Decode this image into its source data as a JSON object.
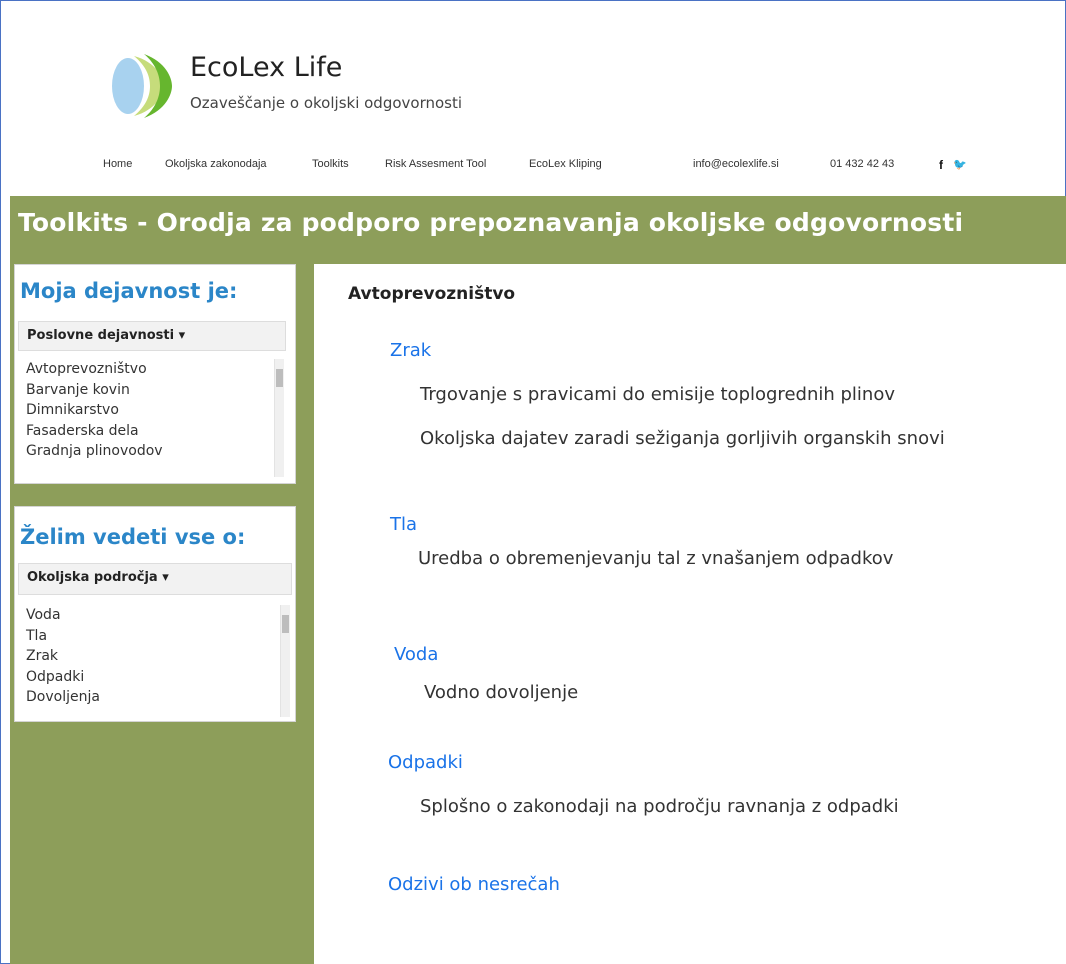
{
  "brand": {
    "title": "EcoLex Life",
    "subtitle": "Ozaveščanje o okoljski odgovornosti"
  },
  "nav": {
    "items": [
      "Home",
      "Okoljska zakonodaja",
      "Toolkits",
      "Risk Assesment Tool",
      "EcoLex Kliping"
    ],
    "email": "info@ecolexlife.si",
    "phone": "01 432 42 43",
    "facebook": "f",
    "twitter": "🐦"
  },
  "banner": {
    "title": "Toolkits - Orodja za podporo prepoznavanja okoljske odgovornosti"
  },
  "sidebar": {
    "activity": {
      "title": "Moja dejavnost je:",
      "dropdown": "Poslovne dejavnosti ▾",
      "items": [
        "Avtoprevozništvo",
        "Barvanje kovin",
        "Dimnikarstvo",
        "Fasaderska dela",
        "Gradnja plinovodov"
      ]
    },
    "topics": {
      "title": "Želim vedeti vse o:",
      "dropdown": "Okoljska področja ▾",
      "items": [
        "Voda",
        "Tla",
        "Zrak",
        "Odpadki",
        "Dovoljenja"
      ]
    }
  },
  "content": {
    "title": "Avtoprevozništvo",
    "sections": [
      {
        "heading": "Zrak",
        "laws": [
          "Trgovanje s pravicami do emisije toplogrednih plinov",
          "Okoljska dajatev zaradi sežiganja gorljivih organskih snovi"
        ]
      },
      {
        "heading": "Tla",
        "laws": [
          "Uredba o obremenjevanju tal z vnašanjem odpadkov"
        ]
      },
      {
        "heading": "Voda",
        "laws": [
          "Vodno dovoljenje"
        ]
      },
      {
        "heading": "Odpadki",
        "laws": [
          "Splošno o zakonodaji na področju ravnanja z odpadki"
        ]
      },
      {
        "heading": "Odzivi ob nesrečah",
        "laws": []
      }
    ]
  },
  "colors": {
    "banner": "#8d9e5a",
    "link": "#1a73e8",
    "panel_title": "#2b86c8"
  }
}
